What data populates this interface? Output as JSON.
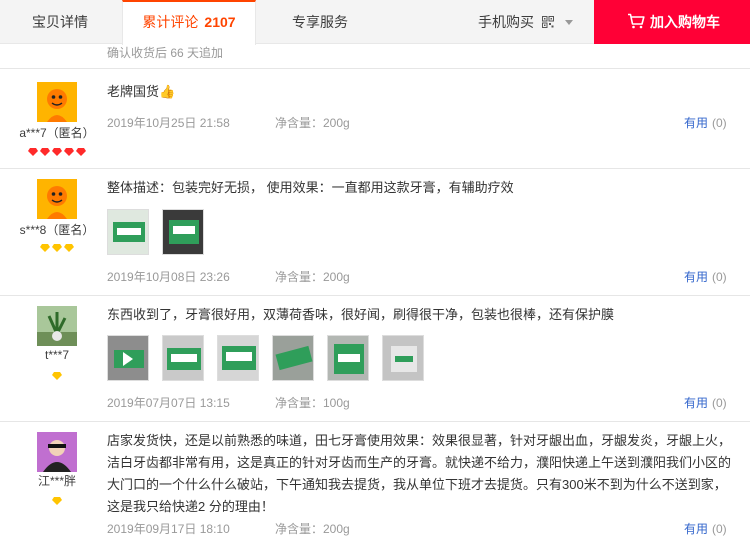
{
  "tabs": {
    "detail": "宝贝详情",
    "reviews_label": "累计评论",
    "reviews_count": "2107",
    "service": "专享服务",
    "mobile_buy": "手机购买",
    "add_to_cart": "加入购物车"
  },
  "colors": {
    "accent": "#ff4400",
    "cart_bg": "#ff0036",
    "link": "#3366cc"
  },
  "prev_review_tail": "确认收货后 66 天追加",
  "reviews": [
    {
      "nick": "a***7（匿名）",
      "avatar_icon": "orange-mascot-avatar",
      "badge_icon": "red-heart-diamond-icon",
      "badge_count": 5,
      "content": "老牌国货👍",
      "date": "2019年10月25日 21:58",
      "spec": "净含量：200g",
      "useful_label": "有用",
      "useful_count": "(0)"
    },
    {
      "nick": "s***8（匿名）",
      "avatar_icon": "orange-mascot-avatar",
      "badge_icon": "gold-diamond-icon",
      "badge_count": 3,
      "content": "整体描述：包装完好无损， 使用效果：一直都用这款牙膏，有辅助疗效",
      "date": "2019年10月08日 23:26",
      "spec": "净含量：200g",
      "useful_label": "有用",
      "useful_count": "(0)",
      "photo_count": 2
    },
    {
      "nick": "t***7",
      "avatar_icon": "plant-photo-avatar",
      "badge_icon": "gold-diamond-icon",
      "badge_count": 1,
      "content": "东西收到了，牙膏很好用，双薄荷香味，很好闻，刷得很干净，包装也很棒，还有保护膜",
      "date": "2019年07月07日 13:15",
      "spec": "净含量：100g",
      "useful_label": "有用",
      "useful_count": "(0)",
      "photo_count": 6
    },
    {
      "nick": "江***胖",
      "avatar_icon": "person-photo-avatar",
      "badge_icon": "gold-diamond-icon",
      "badge_count": 1,
      "content": "店家发货快，还是以前熟悉的味道，田七牙膏使用效果：效果很显著，针对牙龈出血，牙龈发炎，牙龈上火，洁白牙齿都非常有用，这是真正的针对牙齿而生产的牙膏。就快递不给力，濮阳快递上午送到濮阳我们小区的大门口的一个什么什么破站，下午通知我去提货，我从单位下班才去提货。只有300米不到为什么不送到家，这是我只给快递2 分的理由！",
      "date": "2019年09月17日 18:10",
      "spec": "净含量：200g",
      "useful_label": "有用",
      "useful_count": "(0)"
    }
  ]
}
